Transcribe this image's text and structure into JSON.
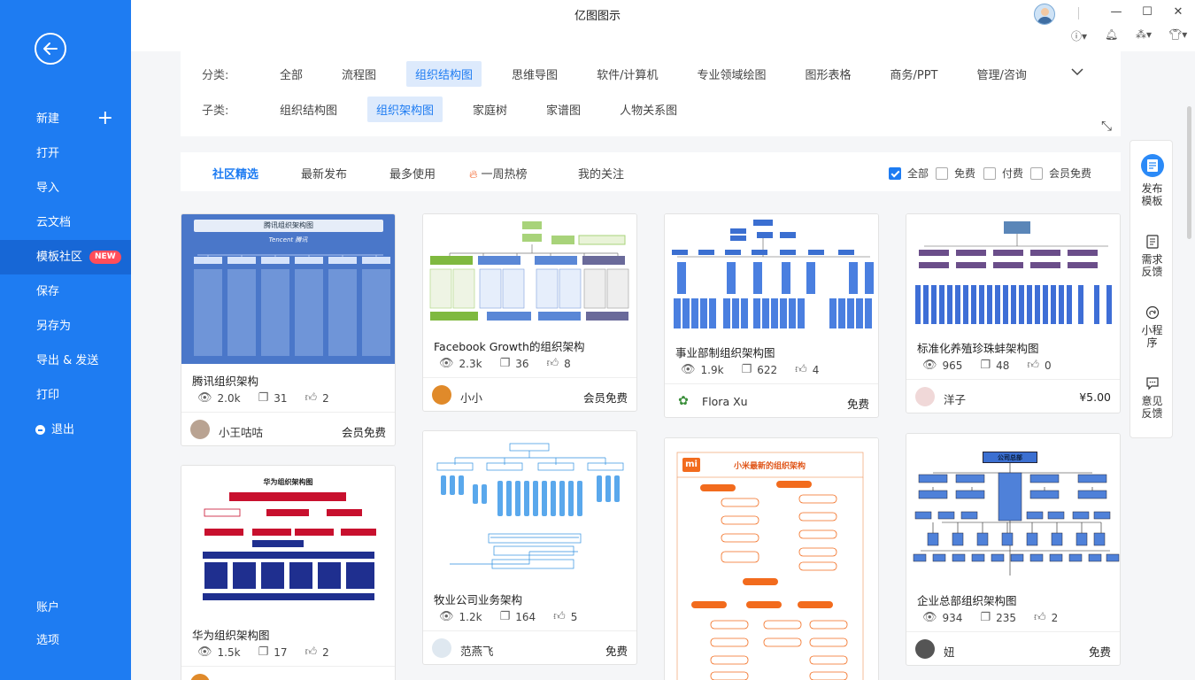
{
  "app": {
    "title": "亿图图示"
  },
  "sidebar": {
    "items": [
      {
        "label": "新建"
      },
      {
        "label": "打开"
      },
      {
        "label": "导入"
      },
      {
        "label": "云文档"
      },
      {
        "label": "模板社区",
        "badge": "NEW"
      },
      {
        "label": "保存"
      },
      {
        "label": "另存为"
      },
      {
        "label": "导出 & 发送"
      },
      {
        "label": "打印"
      },
      {
        "label": "退出"
      }
    ],
    "bottom": [
      {
        "label": "账户"
      },
      {
        "label": "选项"
      }
    ]
  },
  "filters": {
    "category_label": "分类:",
    "categories": [
      "全部",
      "流程图",
      "组织结构图",
      "思维导图",
      "软件/计算机",
      "专业领域绘图",
      "图形表格",
      "商务/PPT",
      "管理/咨询"
    ],
    "active_category": "组织结构图",
    "subcategory_label": "子类:",
    "subcategories": [
      "组织结构图",
      "组织架构图",
      "家庭树",
      "家谱图",
      "人物关系图"
    ],
    "active_subcategory": "组织架构图"
  },
  "tabs": {
    "items": [
      "社区精选",
      "最新发布",
      "最多使用",
      "一周热榜",
      "我的关注"
    ],
    "active": "社区精选",
    "checkboxes": [
      {
        "label": "全部",
        "checked": true
      },
      {
        "label": "免费",
        "checked": false
      },
      {
        "label": "付费",
        "checked": false
      },
      {
        "label": "会员免费",
        "checked": false
      }
    ]
  },
  "cards": [
    {
      "title": "腾讯组织架构",
      "views": "2.0k",
      "copies": "31",
      "likes": "2",
      "author": "小王咕咕",
      "price": "会员免费",
      "thumb_title": "腾讯组织架构图",
      "thumb_sub": "Tencent 腾讯"
    },
    {
      "title": "Facebook Growth的组织架构",
      "views": "2.3k",
      "copies": "36",
      "likes": "8",
      "author": "小小",
      "price": "会员免费"
    },
    {
      "title": "事业部制组织架构图",
      "views": "1.9k",
      "copies": "622",
      "likes": "4",
      "author": "Flora Xu",
      "price": "免费"
    },
    {
      "title": "标准化养殖珍珠蚌架构图",
      "views": "965",
      "copies": "48",
      "likes": "0",
      "author": "洋子",
      "price": "¥5.00"
    },
    {
      "title": "华为组织架构图",
      "views": "1.5k",
      "copies": "17",
      "likes": "2",
      "author": "",
      "price": "",
      "thumb_title": "华为组织架构图"
    },
    {
      "title": "牧业公司业务架构",
      "views": "1.2k",
      "copies": "164",
      "likes": "5",
      "author": "范燕飞",
      "price": "免费"
    },
    {
      "title": "小米最新的组织架构",
      "thumb_title": "小米最新的组织架构"
    },
    {
      "title": "企业总部组织架构图",
      "views": "934",
      "copies": "235",
      "likes": "2",
      "author": "妞",
      "price": "免费",
      "thumb_title": "公司总部"
    }
  ],
  "float_panel": [
    {
      "label": "发布模板"
    },
    {
      "label": "需求反馈"
    },
    {
      "label": "小程序"
    },
    {
      "label": "意见反馈"
    }
  ]
}
